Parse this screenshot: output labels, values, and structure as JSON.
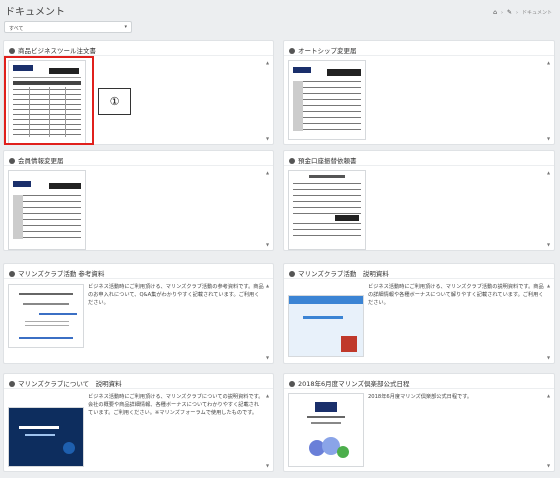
{
  "page": {
    "title": "ドキュメント",
    "breadcrumb_current": "ドキュメント"
  },
  "filter": {
    "selected": "すべて"
  },
  "callout": {
    "label": "①"
  },
  "cards": [
    {
      "title": "商品ビジネスツール注文書",
      "description": ""
    },
    {
      "title": "オートシップ変更届",
      "description": ""
    },
    {
      "title": "会員情報変更届",
      "description": ""
    },
    {
      "title": "預金口座振替依頼書",
      "description": ""
    },
    {
      "title": "マリンズクラブ活動 参考資料",
      "description": "ビジネス活動時にご利用頂ける、マリンズクラブ活動の参考資料です。商品のお申入れについて、Q&A集がわかりやすく記載されています。ご利用ください。"
    },
    {
      "title": "マリンズクラブ活動　説明資料",
      "description": "ビジネス活動時にご利用頂ける、マリンズクラブ活動の説明資料です。商品の詳細情報や各種ボーナスについて解りやすく記載されています。ご利用ください。"
    },
    {
      "title": "マリンズクラブについて　説明資料",
      "description": "ビジネス活動時にご利用頂ける、マリンズクラブについての説明資料です。会社の概要や商品詳細情報、各種ボーナスについてわかりやすく記載されています。ご利用ください。※マリンズフォーラムで使用したものです。"
    },
    {
      "title": "2018年6月度マリンズ倶楽部公式日程",
      "description": "2018年6月度マリンズ倶楽部公式日程です。"
    }
  ]
}
